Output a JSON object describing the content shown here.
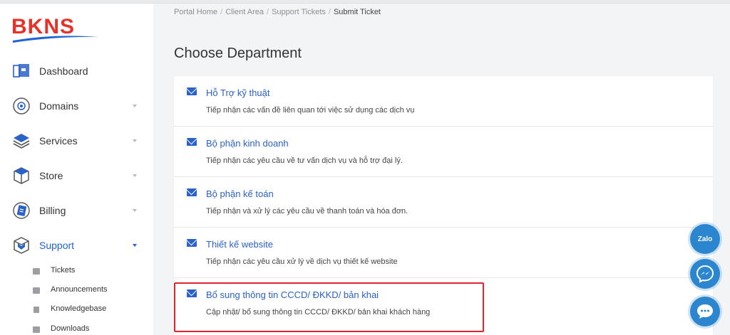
{
  "brand": {
    "logo_text": "BKNS",
    "logo_color": "#e63228",
    "swoosh_color": "#1f63d6"
  },
  "sidebar": {
    "items": [
      {
        "label": "Dashboard",
        "icon": "dashboard-icon",
        "has_caret": false,
        "active": false
      },
      {
        "label": "Domains",
        "icon": "globe-icon",
        "has_caret": true,
        "active": false
      },
      {
        "label": "Services",
        "icon": "cube-layers-icon",
        "has_caret": true,
        "active": false
      },
      {
        "label": "Store",
        "icon": "box-icon",
        "has_caret": true,
        "active": false
      },
      {
        "label": "Billing",
        "icon": "billing-card-icon",
        "has_caret": true,
        "active": false
      },
      {
        "label": "Support",
        "icon": "support-box-icon",
        "has_caret": true,
        "active": true
      }
    ],
    "sub_items": [
      {
        "label": "Tickets",
        "icon": "inbox-icon"
      },
      {
        "label": "Announcements",
        "icon": "chat-icon"
      },
      {
        "label": "Knowledgebase",
        "icon": "book-icon"
      },
      {
        "label": "Downloads",
        "icon": "download-icon"
      }
    ]
  },
  "breadcrumb": {
    "items": [
      "Portal Home",
      "Client Area",
      "Support Tickets"
    ],
    "current": "Submit Ticket",
    "separator": "/"
  },
  "page_title": "Choose Department",
  "departments": [
    {
      "title": "Hỗ Trợ kỹ thuật",
      "description": "Tiếp nhận các vấn đề liên quan tới việc sử dụng các dịch vụ"
    },
    {
      "title": "Bộ phận kinh doanh",
      "description": "Tiếp nhận các yêu cầu về tư vấn dịch vụ và hỗ trợ đại lý."
    },
    {
      "title": "Bộ phận kế toán",
      "description": "Tiếp nhận và xử lý các yêu cầu về thanh toán và hóa đơn."
    },
    {
      "title": "Thiết kế website",
      "description": "Tiếp nhận các yêu cầu xử lý về dịch vụ thiết kế website"
    },
    {
      "title": "Bổ sung thông tin CCCD/ ĐKKD/ bản khai",
      "description": "Cập nhật/ bổ sung thông tin CCCD/ ĐKKD/ bản khai khách hàng"
    }
  ],
  "floating": {
    "zalo_label": "Zalo"
  },
  "colors": {
    "accent": "#1f63d6",
    "link": "#2a62c9",
    "highlight": "#e0262b",
    "fab": "#2b86cf"
  }
}
